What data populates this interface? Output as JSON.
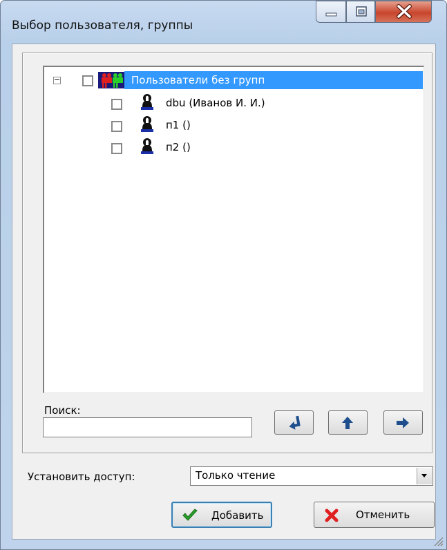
{
  "window": {
    "title": "Выбор пользователя, группы",
    "controls": [
      "minimize-icon",
      "maximize-icon",
      "close-icon"
    ]
  },
  "tree": {
    "group": {
      "label": "Пользователи без групп",
      "expanded": true,
      "checked": false,
      "selected": true,
      "icon": "users-group-icon"
    },
    "users": [
      {
        "label": "dbu (Иванов И. И.)",
        "checked": false,
        "icon": "user-icon"
      },
      {
        "label": "п1 ()",
        "checked": false,
        "icon": "user-icon"
      },
      {
        "label": "п2 ()",
        "checked": false,
        "icon": "user-icon"
      }
    ]
  },
  "search": {
    "label": "Поиск:",
    "value": ""
  },
  "nav_buttons": [
    "arrow-down-left-icon",
    "arrow-up-icon",
    "arrow-right-icon"
  ],
  "access": {
    "label": "Установить доступ:",
    "selected": "Только чтение"
  },
  "buttons": {
    "add": "Добавить",
    "cancel": "Отменить"
  },
  "colors": {
    "selection": "#3399ff",
    "check": "#2aa02a",
    "cancel_x": "#e02020",
    "close_button": "#c9452c"
  }
}
